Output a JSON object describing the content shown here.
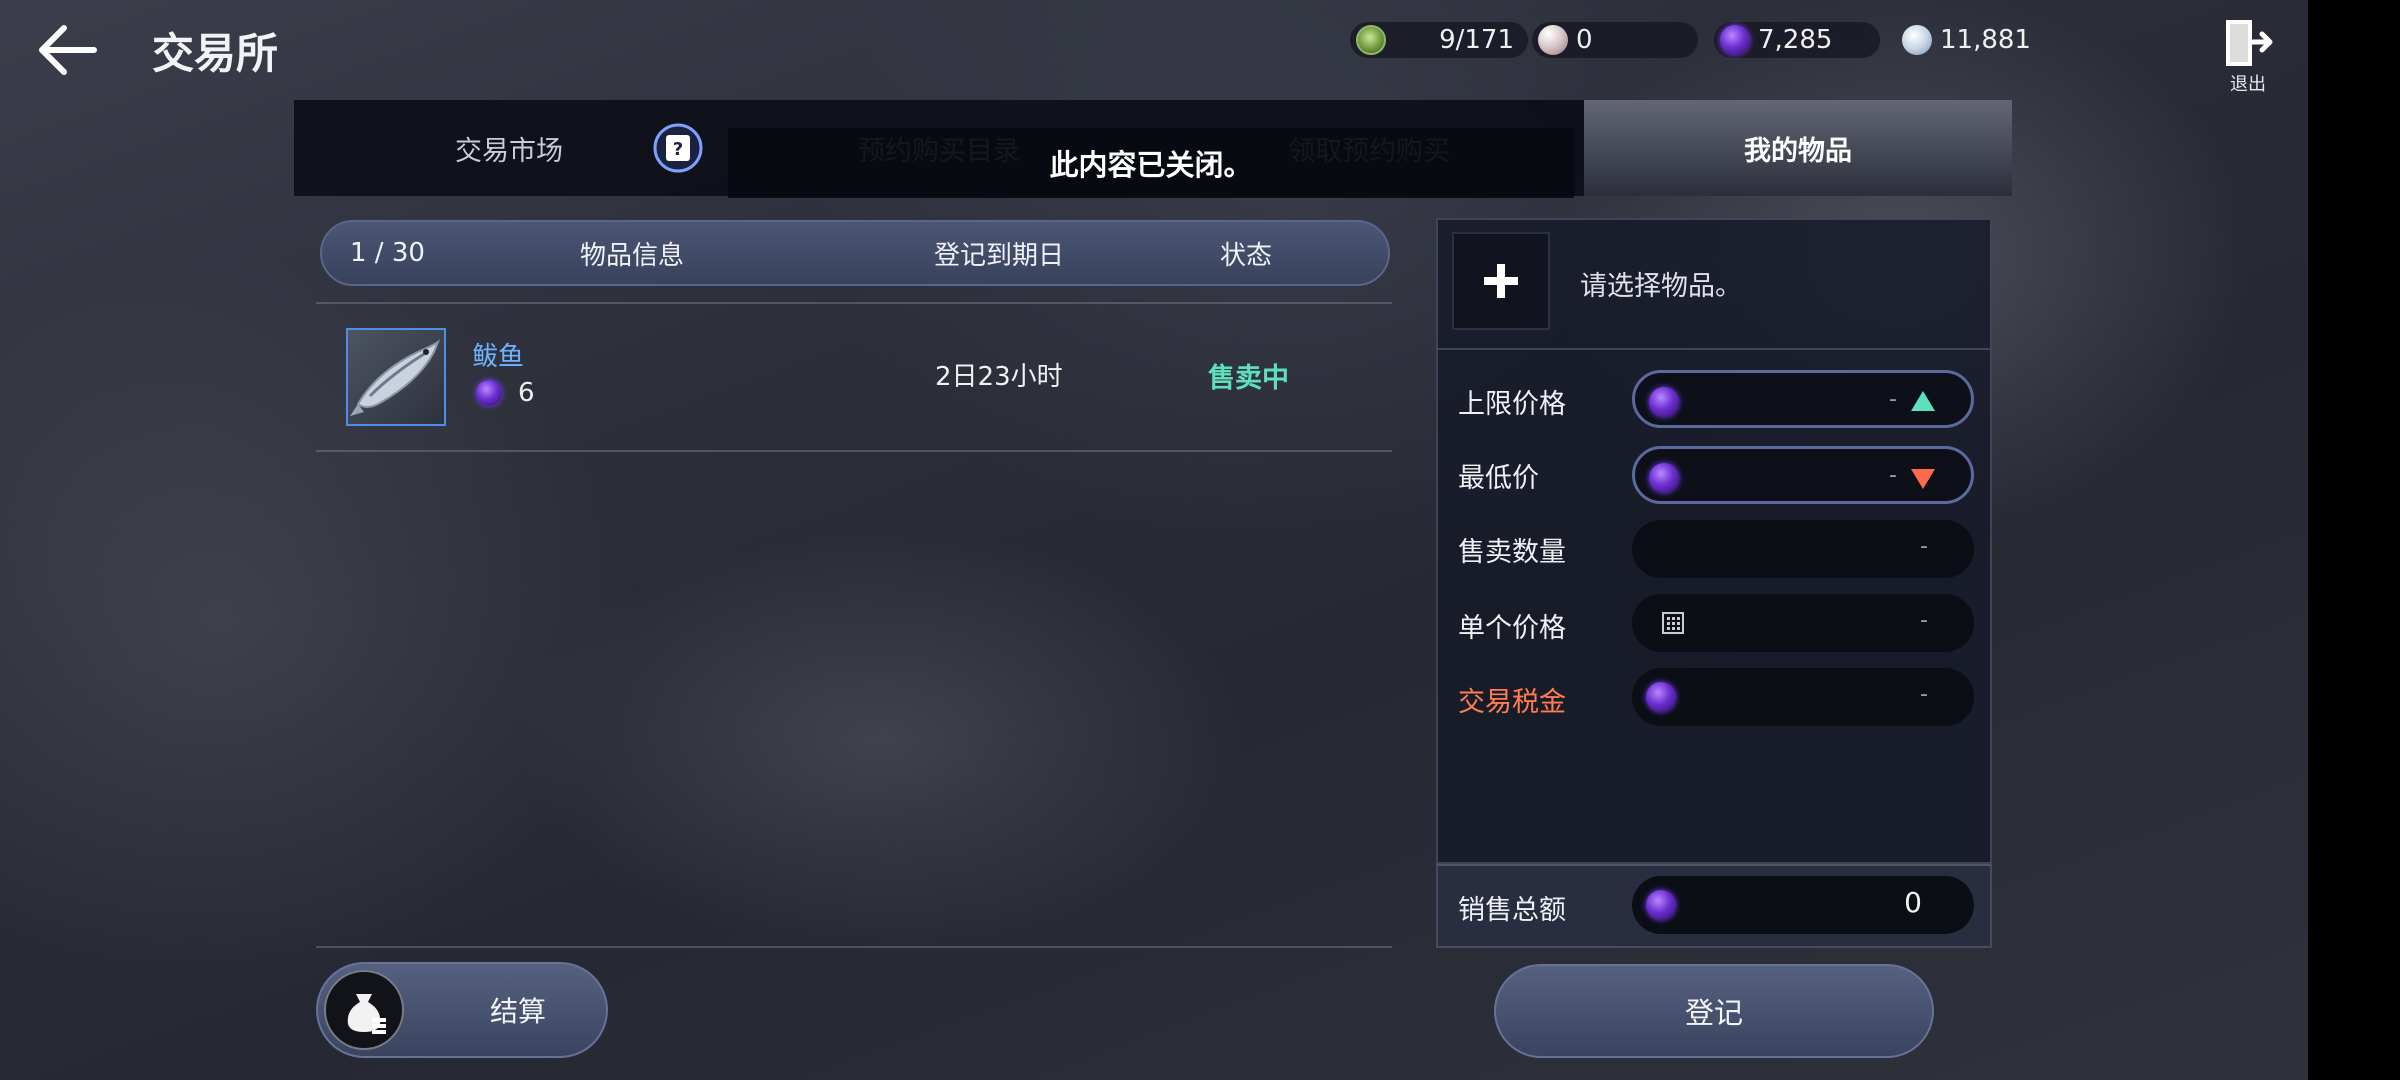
{
  "header": {
    "title": "交易所",
    "exit_label": "退出"
  },
  "currencies": [
    {
      "icon": "green-badge-icon",
      "value": "9/171"
    },
    {
      "icon": "pearl-icon",
      "value": "0"
    },
    {
      "icon": "purple-gem-icon",
      "value": "7,285"
    },
    {
      "icon": "silver-coin-icon",
      "value": "11,881"
    }
  ],
  "tabs": {
    "market": "交易市场",
    "reserve": "预约购买目录",
    "claim": "领取预约购买",
    "mine": "我的物品",
    "active": "mine"
  },
  "toast": "此内容已关闭。",
  "list": {
    "count": "1 / 30",
    "columns": {
      "info": "物品信息",
      "expiry": "登记到期日",
      "status": "状态"
    },
    "items": [
      {
        "name": "鲅鱼",
        "quantity": "6",
        "expiry": "2日23小时",
        "status": "售卖中"
      }
    ]
  },
  "settle_label": "结算",
  "panel": {
    "select_hint": "请选择物品。",
    "fields": {
      "max_price": {
        "label": "上限价格",
        "value": "-"
      },
      "min_price": {
        "label": "最低价",
        "value": "-"
      },
      "sell_qty": {
        "label": "售卖数量",
        "value": "-"
      },
      "unit_price": {
        "label": "单个价格",
        "value": "-"
      },
      "tax": {
        "label": "交易税金",
        "value": "-"
      }
    },
    "total": {
      "label": "销售总额",
      "value": "0"
    },
    "register_label": "登记"
  },
  "colors": {
    "accent_teal": "#5fe0bd",
    "accent_orange": "#ff7c52",
    "item_name_blue": "#6fb2ff",
    "gem_purple": "#6d2fd1"
  }
}
